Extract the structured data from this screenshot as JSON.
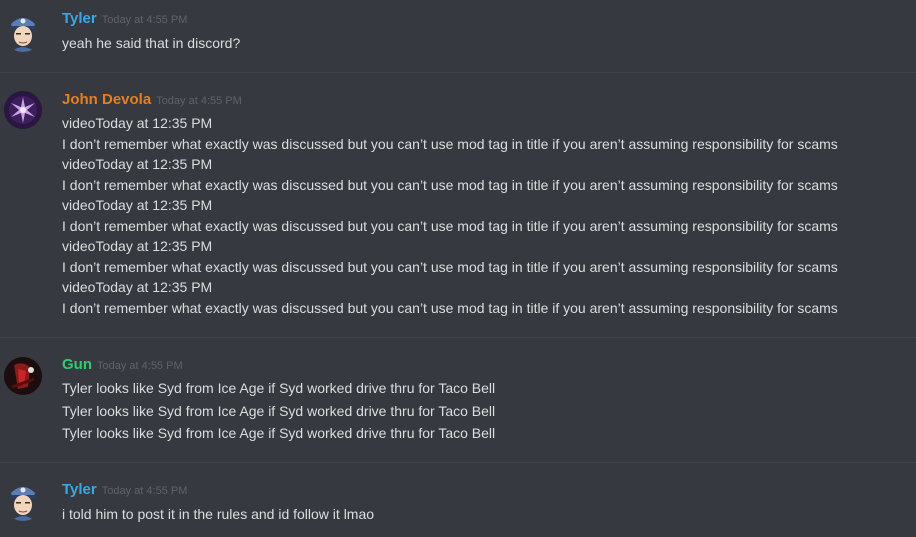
{
  "messages": [
    {
      "author": "Tyler",
      "author_color": "#3498db",
      "timestamp": "Today at 4:55 PM",
      "avatar": "tyler-avatar",
      "lines": [
        "yeah he said that in discord?"
      ]
    },
    {
      "author": "John Devola",
      "author_color": "#e67e22",
      "timestamp": "Today at 4:55 PM",
      "avatar": "john-devola-avatar",
      "lines": [
        "videoToday at 12:35 PM",
        "I don’t remember what exactly was discussed but you can’t use mod tag in title if you aren’t assuming responsibility for scams",
        "videoToday at 12:35 PM",
        "I don’t remember what exactly was discussed but you can’t use mod tag in title if you aren’t assuming responsibility for scams",
        "videoToday at 12:35 PM",
        "I don’t remember what exactly was discussed but you can’t use mod tag in title if you aren’t assuming responsibility for scams",
        "videoToday at 12:35 PM",
        "I don’t remember what exactly was discussed but you can’t use mod tag in title if you aren’t assuming responsibility for scams",
        "videoToday at 12:35 PM",
        "I don’t remember what exactly was discussed but you can’t use mod tag in title if you aren’t assuming responsibility for scams"
      ]
    },
    {
      "author": "Gun",
      "author_color": "#2ecc71",
      "timestamp": "Today at 4:55 PM",
      "avatar": "gun-avatar",
      "lines": [
        "Tyler looks like Syd from Ice Age if Syd worked drive thru for Taco Bell",
        "Tyler looks like Syd from Ice Age if Syd worked drive thru for Taco Bell",
        "Tyler looks like Syd from Ice Age if Syd worked drive thru for Taco Bell"
      ]
    },
    {
      "author": "Tyler",
      "author_color": "#3498db",
      "timestamp": "Today at 4:55 PM",
      "avatar": "tyler-avatar",
      "lines": [
        "i told him to post it in the rules and id follow it lmao"
      ]
    }
  ]
}
